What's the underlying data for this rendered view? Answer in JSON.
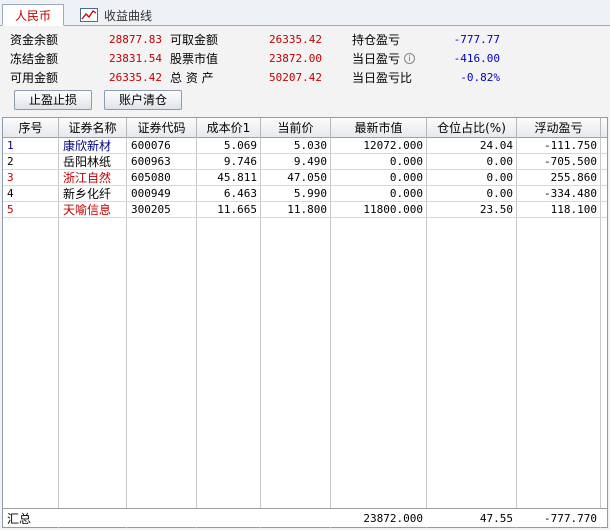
{
  "tabs": {
    "active": "人民币",
    "second": "收益曲线"
  },
  "summary": {
    "fund_balance_label": "资金余额",
    "fund_balance": "28877.83",
    "withdrawable_label": "可取金额",
    "withdrawable": "26335.42",
    "position_pl_label": "持仓盈亏",
    "position_pl": "-777.77",
    "frozen_label": "冻结金额",
    "frozen": "23831.54",
    "stock_value_label": "股票市值",
    "stock_value": "23872.00",
    "day_pl_label": "当日盈亏",
    "day_pl": "-416.00",
    "available_label": "可用金额",
    "available": "26335.42",
    "total_assets_label": "总 资 产",
    "total_assets": "50207.42",
    "day_pl_ratio_label": "当日盈亏比",
    "day_pl_ratio": "-0.82%"
  },
  "buttons": {
    "stop_label": "止盈止损",
    "clear_label": "账户清仓"
  },
  "table": {
    "headers": [
      "序号",
      "证券名称",
      "证券代码",
      "成本价1",
      "当前价",
      "最新市值",
      "仓位占比(%)",
      "浮动盈亏"
    ],
    "rows": [
      {
        "no": "1",
        "name": "康欣新材",
        "code": "600076",
        "cost": "5.069",
        "price": "5.030",
        "mv": "12072.000",
        "pct": "24.04",
        "pl": "-111.750",
        "color": "#000080"
      },
      {
        "no": "2",
        "name": "岳阳林纸",
        "code": "600963",
        "cost": "9.746",
        "price": "9.490",
        "mv": "0.000",
        "pct": "0.00",
        "pl": "-705.500",
        "color": "#000000"
      },
      {
        "no": "3",
        "name": "浙江自然",
        "code": "605080",
        "cost": "45.811",
        "price": "47.050",
        "mv": "0.000",
        "pct": "0.00",
        "pl": "255.860",
        "color": "#c00000"
      },
      {
        "no": "4",
        "name": "新乡化纤",
        "code": "000949",
        "cost": "6.463",
        "price": "5.990",
        "mv": "0.000",
        "pct": "0.00",
        "pl": "-334.480",
        "color": "#000000"
      },
      {
        "no": "5",
        "name": "天喻信息",
        "code": "300205",
        "cost": "11.665",
        "price": "11.800",
        "mv": "11800.000",
        "pct": "23.50",
        "pl": "118.100",
        "color": "#c00000"
      }
    ],
    "totals": {
      "label": "汇总",
      "mv": "23872.000",
      "pct": "47.55",
      "pl": "-777.770"
    }
  },
  "colors": {
    "positive": "#c00000",
    "negative": "#0000c0",
    "accent_border": "#8c9bb0"
  }
}
